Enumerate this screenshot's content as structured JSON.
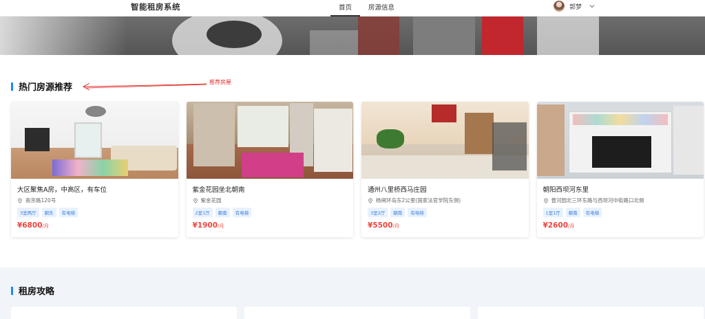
{
  "header": {
    "logo": "智能租房系统",
    "nav": [
      {
        "label": "首页",
        "active": true
      },
      {
        "label": "房源信息",
        "active": false
      }
    ],
    "user": {
      "name": "郭梦"
    }
  },
  "recommend": {
    "title": "热门房源推荐",
    "annotation": "推荐房屋",
    "cards": [
      {
        "title": "大区聚焦A房，中高区，有车位",
        "address": "南京路120号",
        "tags": [
          "3室两厅",
          "朝东",
          "有电梯"
        ],
        "price": "¥6800",
        "unit": "/月"
      },
      {
        "title": "紫金花园坐北朝南",
        "address": "紫金花园",
        "tags": [
          "2室1厅",
          "朝南",
          "有电梯"
        ],
        "price": "¥1900",
        "unit": "/月"
      },
      {
        "title": "通州八里桥西马庄园",
        "address": "杨闸环岛东2公里(国家法官学院东侧)",
        "tags": [
          "3室2厅",
          "朝南",
          "有电梯"
        ],
        "price": "¥5500",
        "unit": "/月"
      },
      {
        "title": "朝阳西坝河东里",
        "address": "普河园北三环东路与西坝河中街路口北侧",
        "tags": [
          "1室1厅",
          "朝南",
          "有电梯"
        ],
        "price": "¥2600",
        "unit": "/月"
      }
    ]
  },
  "guide": {
    "title": "租房攻略"
  },
  "colors": {
    "accent": "#1f86ff",
    "price": "#f0443c",
    "annotation": "#e0302b",
    "tag_text": "#3f7fd6",
    "tag_bg": "#e8f2ff"
  }
}
